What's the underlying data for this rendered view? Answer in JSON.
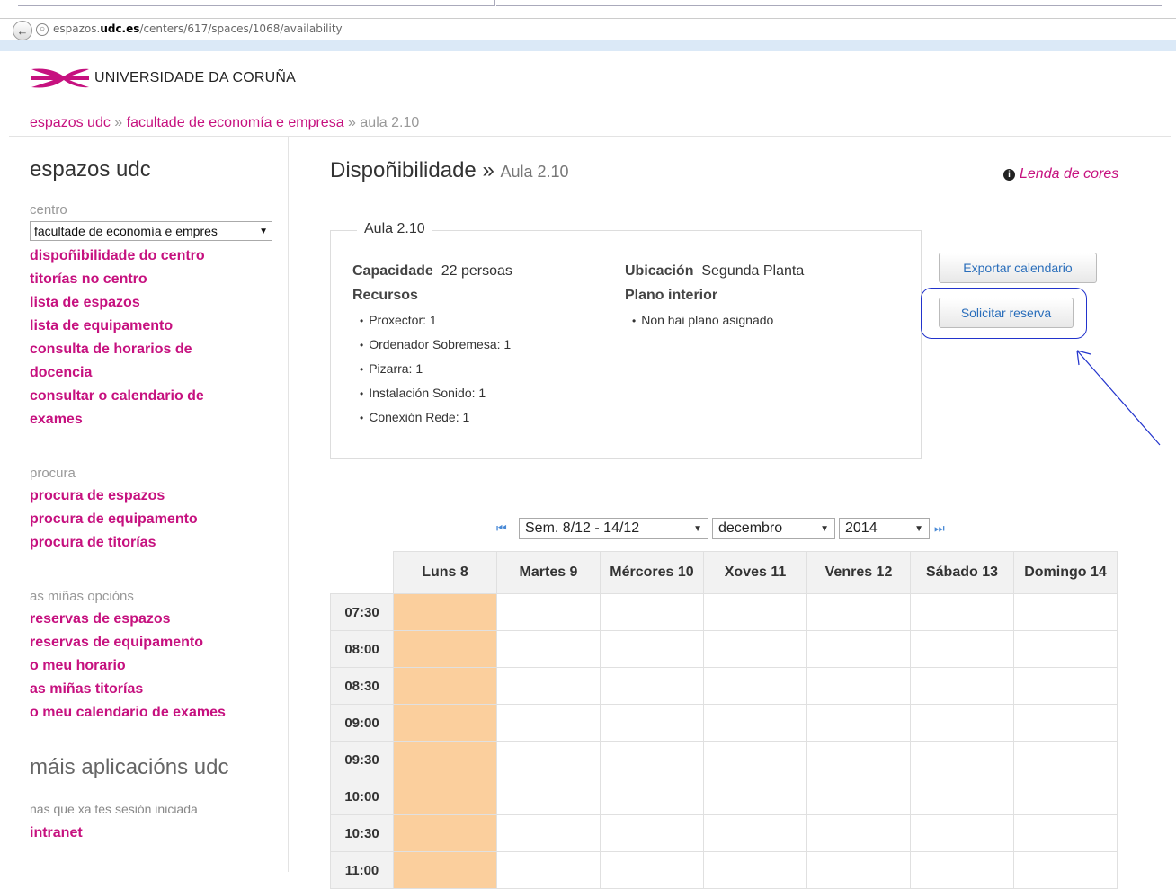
{
  "browser": {
    "url_prefix": "espazos.",
    "url_domain": "udc.es",
    "url_path": "/centers/617/spaces/1068/availability"
  },
  "header": {
    "logo_text": "UNIVERSIDADE DA CORUÑA",
    "breadcrumb": [
      "espazos udc",
      "facultade de economía e empresa",
      "aula 2.10"
    ],
    "breadcrumb_sep": "»"
  },
  "sidebar": {
    "title": "espazos udc",
    "centro_label": "centro",
    "centro_select": "facultade de economía e empres",
    "centro_links": [
      "dispoñibilidade do centro",
      "titorías no centro",
      "lista de espazos",
      "lista de equipamento",
      "consulta de horarios de",
      "docencia",
      "consultar o calendario de",
      "exames"
    ],
    "procura_label": "procura",
    "procura_links": [
      "procura de espazos",
      "procura de equipamento",
      "procura de titorías"
    ],
    "opcions_label": "as miñas opcións",
    "opcions_links": [
      "reservas de espazos",
      "reservas de equipamento",
      "o meu horario",
      "as miñas titorías",
      "o meu calendario de exames"
    ],
    "more_title": "máis aplicacións udc",
    "more_note": "nas que xa tes sesión iniciada",
    "more_links": [
      "intranet"
    ]
  },
  "main": {
    "title": "Dispoñibilidade",
    "title_sep": "»",
    "subtitle": "Aula 2.10",
    "legend_link": "Lenda de cores",
    "room": {
      "legend": "Aula 2.10",
      "capacity_label": "Capacidade",
      "capacity_value": "22 persoas",
      "resources_label": "Recursos",
      "resources": [
        "Proxector: 1",
        "Ordenador Sobremesa: 1",
        "Pizarra: 1",
        "Instalación Sonido: 1",
        "Conexión Rede: 1"
      ],
      "location_label": "Ubicación",
      "location_value": "Segunda Planta",
      "plan_label": "Plano interior",
      "plan_items": [
        "Non hai plano asignado"
      ]
    },
    "buttons": {
      "export": "Exportar calendario",
      "request": "Solicitar reserva"
    }
  },
  "calendar": {
    "week": "Sem. 8/12 - 14/12",
    "month": "decembro",
    "year": "2014",
    "days": [
      "Luns 8",
      "Martes 9",
      "Mércores 10",
      "Xoves 11",
      "Venres 12",
      "Sábado 13",
      "Domingo 14"
    ],
    "times": [
      "07:30",
      "08:00",
      "08:30",
      "09:00",
      "09:30",
      "10:00",
      "10:30",
      "11:00"
    ],
    "busy_day_index": 0,
    "busy_color": "#fbcf9d"
  },
  "colors": {
    "link": "#c6117f",
    "button_text": "#2a6ebb",
    "annotation": "#2233cc"
  },
  "icons": {
    "back": "back-arrow-icon",
    "globe": "globe-icon",
    "info": "info-icon",
    "first": "first-page-icon",
    "last": "last-page-icon"
  }
}
